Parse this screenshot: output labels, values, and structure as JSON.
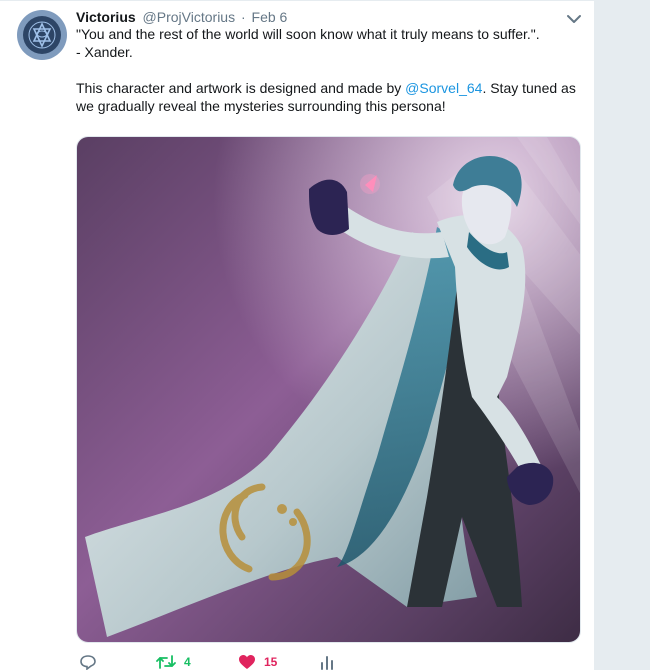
{
  "tweet": {
    "display_name": "Victorius",
    "handle": "@ProjVictorius",
    "separator": "·",
    "date": "Feb 6",
    "quote_line": "\"You and the rest of the world will soon know what it truly means to suffer.\".",
    "attribution_line": "- Xander.",
    "body_prefix": "This character and artwork is designed and made by ",
    "mention": "@Sorvel_64",
    "body_suffix": ". Stay tuned as we gradually reveal the mysteries surrounding this persona!"
  },
  "actions": {
    "reply_count": "",
    "retweet_count": "4",
    "like_count": "15"
  },
  "colors": {
    "link": "#1b95e0",
    "retweet": "#17bf63",
    "like": "#e0245e",
    "muted": "#657786"
  },
  "icons": {
    "avatar": "unicursal-hexagram-icon",
    "caret": "chevron-down-icon",
    "reply": "reply-icon",
    "retweet": "retweet-icon",
    "like": "heart-icon",
    "stats": "bar-chart-icon"
  }
}
